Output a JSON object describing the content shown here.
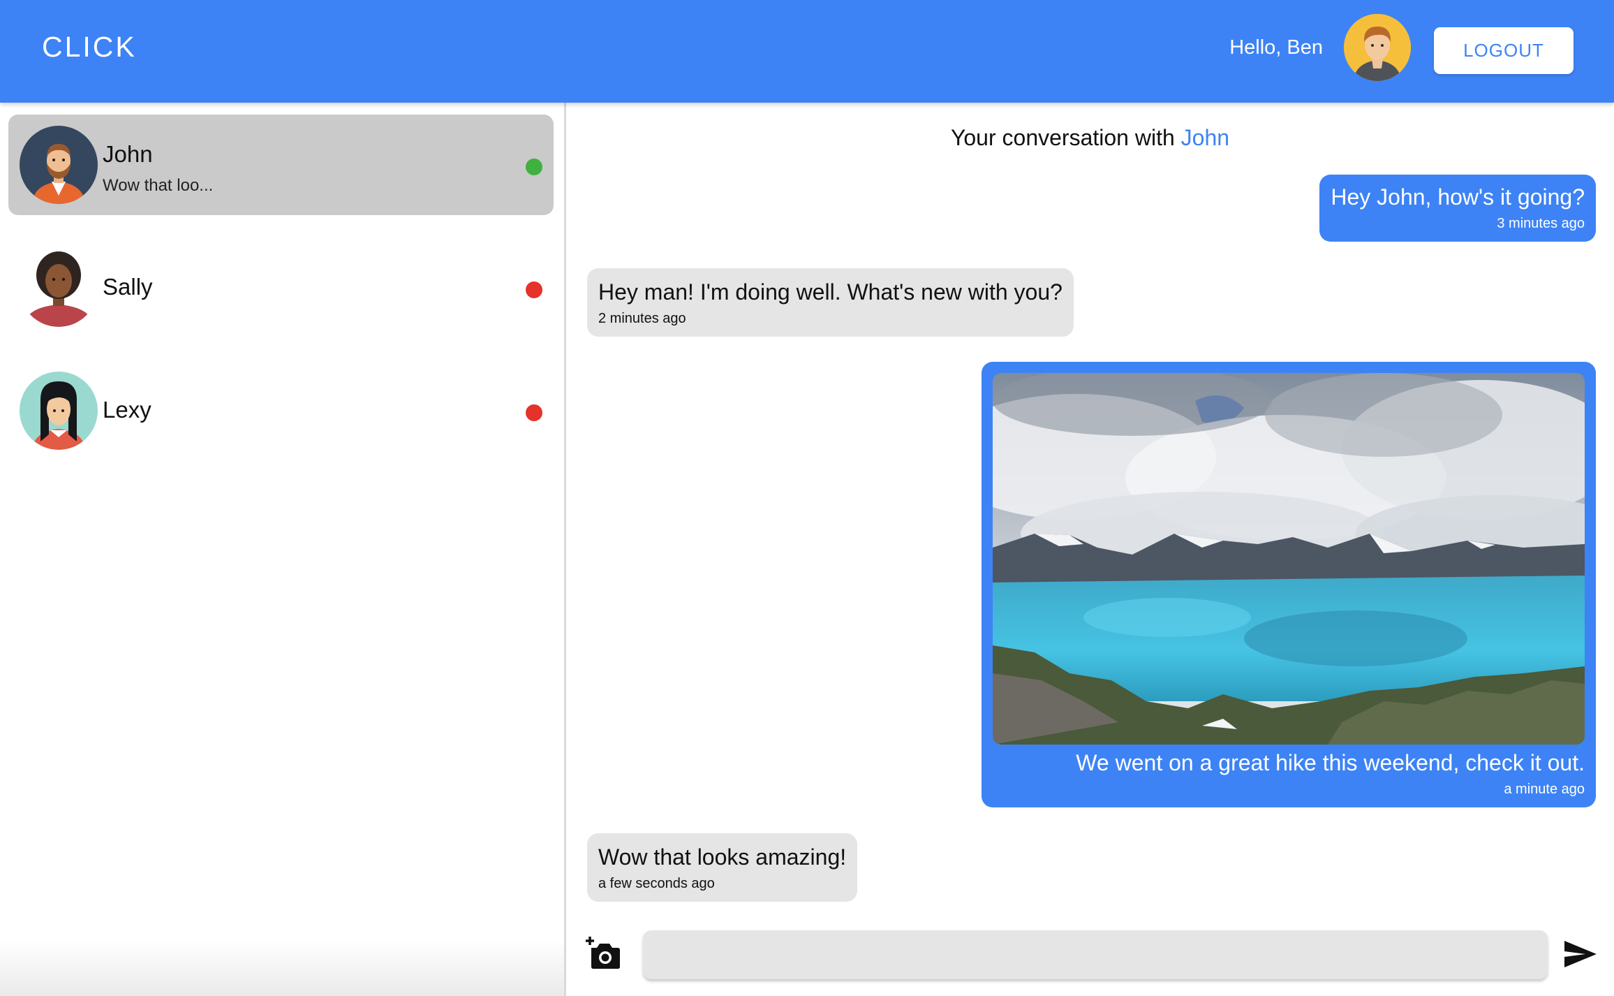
{
  "header": {
    "brand": "CLICK",
    "greeting": "Hello, Ben",
    "logout_label": "LOGOUT",
    "color": "#3d83f5"
  },
  "sidebar": {
    "contacts": [
      {
        "name": "John",
        "preview": "Wow that loo...",
        "status": "online",
        "status_color": "#3fb13f",
        "active": true
      },
      {
        "name": "Sally",
        "preview": "",
        "status": "offline",
        "status_color": "#e5322a",
        "active": false
      },
      {
        "name": "Lexy",
        "preview": "",
        "status": "offline",
        "status_color": "#e5322a",
        "active": false
      }
    ]
  },
  "chat": {
    "title_prefix": "Your conversation with",
    "title_name": "John",
    "messages": [
      {
        "direction": "out",
        "text": "Hey John, how's it going?",
        "time": "3 minutes ago"
      },
      {
        "direction": "in",
        "text": "Hey man! I'm doing well. What's new with you?",
        "time": "2 minutes ago"
      },
      {
        "direction": "out",
        "image": "mountain-lake-photo",
        "text": "We went on a great hike this weekend, check it out.",
        "time": "a minute ago"
      },
      {
        "direction": "in",
        "text": "Wow that looks amazing!",
        "time": "a few seconds ago"
      }
    ],
    "composer": {
      "value": "",
      "placeholder": ""
    },
    "icons": {
      "camera": "add-photo-camera-icon",
      "send": "send-arrow-icon"
    }
  }
}
